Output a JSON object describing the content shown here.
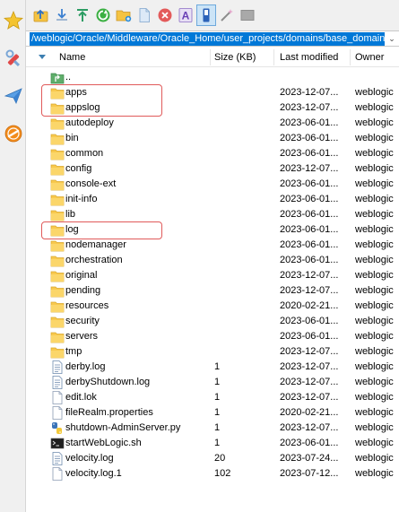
{
  "path": "/weblogic/Oracle/Middleware/Oracle_Home/user_projects/domains/base_domain/",
  "columns": {
    "name": "Name",
    "size": "Size (KB)",
    "modified": "Last modified",
    "owner": "Owner"
  },
  "left_sidebar": [
    "star-icon",
    "tools-icon",
    "send-icon",
    "no-entry-icon"
  ],
  "toolbar": [
    "upload-icon",
    "download-icon",
    "upload-arrow-icon",
    "refresh-icon",
    "new-folder-icon",
    "new-file-icon",
    "cancel-icon",
    "rename-icon",
    "sync-browse-icon",
    "magic-wand-icon",
    "terminal-icon"
  ],
  "highlight_color": "#e05a5a",
  "files": [
    {
      "name": "..",
      "size": "",
      "modified": "",
      "owner": "",
      "icon": "parent-dir-icon"
    },
    {
      "name": "apps",
      "size": "",
      "modified": "2023-12-07...",
      "owner": "weblogic",
      "icon": "folder-icon"
    },
    {
      "name": "appslog",
      "size": "",
      "modified": "2023-12-07...",
      "owner": "weblogic",
      "icon": "folder-icon"
    },
    {
      "name": "autodeploy",
      "size": "",
      "modified": "2023-06-01...",
      "owner": "weblogic",
      "icon": "folder-icon"
    },
    {
      "name": "bin",
      "size": "",
      "modified": "2023-06-01...",
      "owner": "weblogic",
      "icon": "folder-icon"
    },
    {
      "name": "common",
      "size": "",
      "modified": "2023-06-01...",
      "owner": "weblogic",
      "icon": "folder-icon"
    },
    {
      "name": "config",
      "size": "",
      "modified": "2023-12-07...",
      "owner": "weblogic",
      "icon": "folder-icon"
    },
    {
      "name": "console-ext",
      "size": "",
      "modified": "2023-06-01...",
      "owner": "weblogic",
      "icon": "folder-icon"
    },
    {
      "name": "init-info",
      "size": "",
      "modified": "2023-06-01...",
      "owner": "weblogic",
      "icon": "folder-icon"
    },
    {
      "name": "lib",
      "size": "",
      "modified": "2023-06-01...",
      "owner": "weblogic",
      "icon": "folder-icon"
    },
    {
      "name": "log",
      "size": "",
      "modified": "2023-06-01...",
      "owner": "weblogic",
      "icon": "folder-icon"
    },
    {
      "name": "nodemanager",
      "size": "",
      "modified": "2023-06-01...",
      "owner": "weblogic",
      "icon": "folder-icon"
    },
    {
      "name": "orchestration",
      "size": "",
      "modified": "2023-06-01...",
      "owner": "weblogic",
      "icon": "folder-icon"
    },
    {
      "name": "original",
      "size": "",
      "modified": "2023-12-07...",
      "owner": "weblogic",
      "icon": "folder-icon"
    },
    {
      "name": "pending",
      "size": "",
      "modified": "2023-12-07...",
      "owner": "weblogic",
      "icon": "folder-icon"
    },
    {
      "name": "resources",
      "size": "",
      "modified": "2020-02-21...",
      "owner": "weblogic",
      "icon": "folder-icon"
    },
    {
      "name": "security",
      "size": "",
      "modified": "2023-06-01...",
      "owner": "weblogic",
      "icon": "folder-icon"
    },
    {
      "name": "servers",
      "size": "",
      "modified": "2023-06-01...",
      "owner": "weblogic",
      "icon": "folder-icon"
    },
    {
      "name": "tmp",
      "size": "",
      "modified": "2023-12-07...",
      "owner": "weblogic",
      "icon": "folder-icon"
    },
    {
      "name": "derby.log",
      "size": "1",
      "modified": "2023-12-07...",
      "owner": "weblogic",
      "icon": "text-file-icon"
    },
    {
      "name": "derbyShutdown.log",
      "size": "1",
      "modified": "2023-12-07...",
      "owner": "weblogic",
      "icon": "text-file-icon"
    },
    {
      "name": "edit.lok",
      "size": "1",
      "modified": "2023-12-07...",
      "owner": "weblogic",
      "icon": "blank-file-icon"
    },
    {
      "name": "fileRealm.properties",
      "size": "1",
      "modified": "2020-02-21...",
      "owner": "weblogic",
      "icon": "blank-file-icon"
    },
    {
      "name": "shutdown-AdminServer.py",
      "size": "1",
      "modified": "2023-12-07...",
      "owner": "weblogic",
      "icon": "python-file-icon"
    },
    {
      "name": "startWebLogic.sh",
      "size": "1",
      "modified": "2023-06-01...",
      "owner": "weblogic",
      "icon": "shell-script-icon"
    },
    {
      "name": "velocity.log",
      "size": "20",
      "modified": "2023-07-24...",
      "owner": "weblogic",
      "icon": "text-file-icon"
    },
    {
      "name": "velocity.log.1",
      "size": "102",
      "modified": "2023-07-12...",
      "owner": "weblogic",
      "icon": "blank-file-icon"
    }
  ]
}
